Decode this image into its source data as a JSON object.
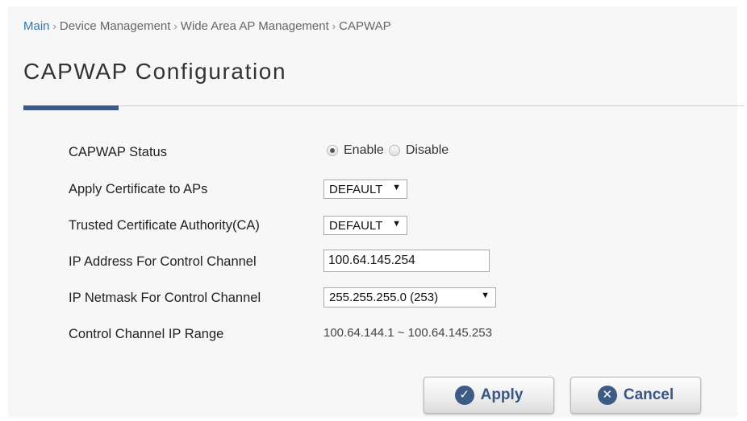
{
  "breadcrumb": {
    "items": [
      "Main",
      "Device Management",
      "Wide Area AP Management",
      "CAPWAP"
    ],
    "separator": "›"
  },
  "page": {
    "title": "CAPWAP Configuration"
  },
  "form": {
    "capwap_status": {
      "label": "CAPWAP Status",
      "options": [
        "Enable",
        "Disable"
      ],
      "selected": "Enable"
    },
    "apply_certificate": {
      "label": "Apply Certificate to APs",
      "value": "DEFAULT"
    },
    "trusted_ca": {
      "label": "Trusted Certificate Authority(CA)",
      "value": "DEFAULT"
    },
    "control_ip": {
      "label": "IP Address For Control Channel",
      "value": "100.64.145.254"
    },
    "control_netmask": {
      "label": "IP Netmask For Control Channel",
      "value": "255.255.255.0 (253)"
    },
    "control_range": {
      "label": "Control Channel IP Range",
      "value": "100.64.144.1 ~ 100.64.145.253"
    }
  },
  "buttons": {
    "apply_label": "Apply",
    "cancel_label": "Cancel"
  },
  "icons": {
    "apply": "check-circle-icon",
    "cancel": "x-circle-icon",
    "dropdown": "triangle-down-icon"
  },
  "colors": {
    "link": "#2a7ab8",
    "accent": "#3b5a8c",
    "button_text": "#3a5680"
  }
}
